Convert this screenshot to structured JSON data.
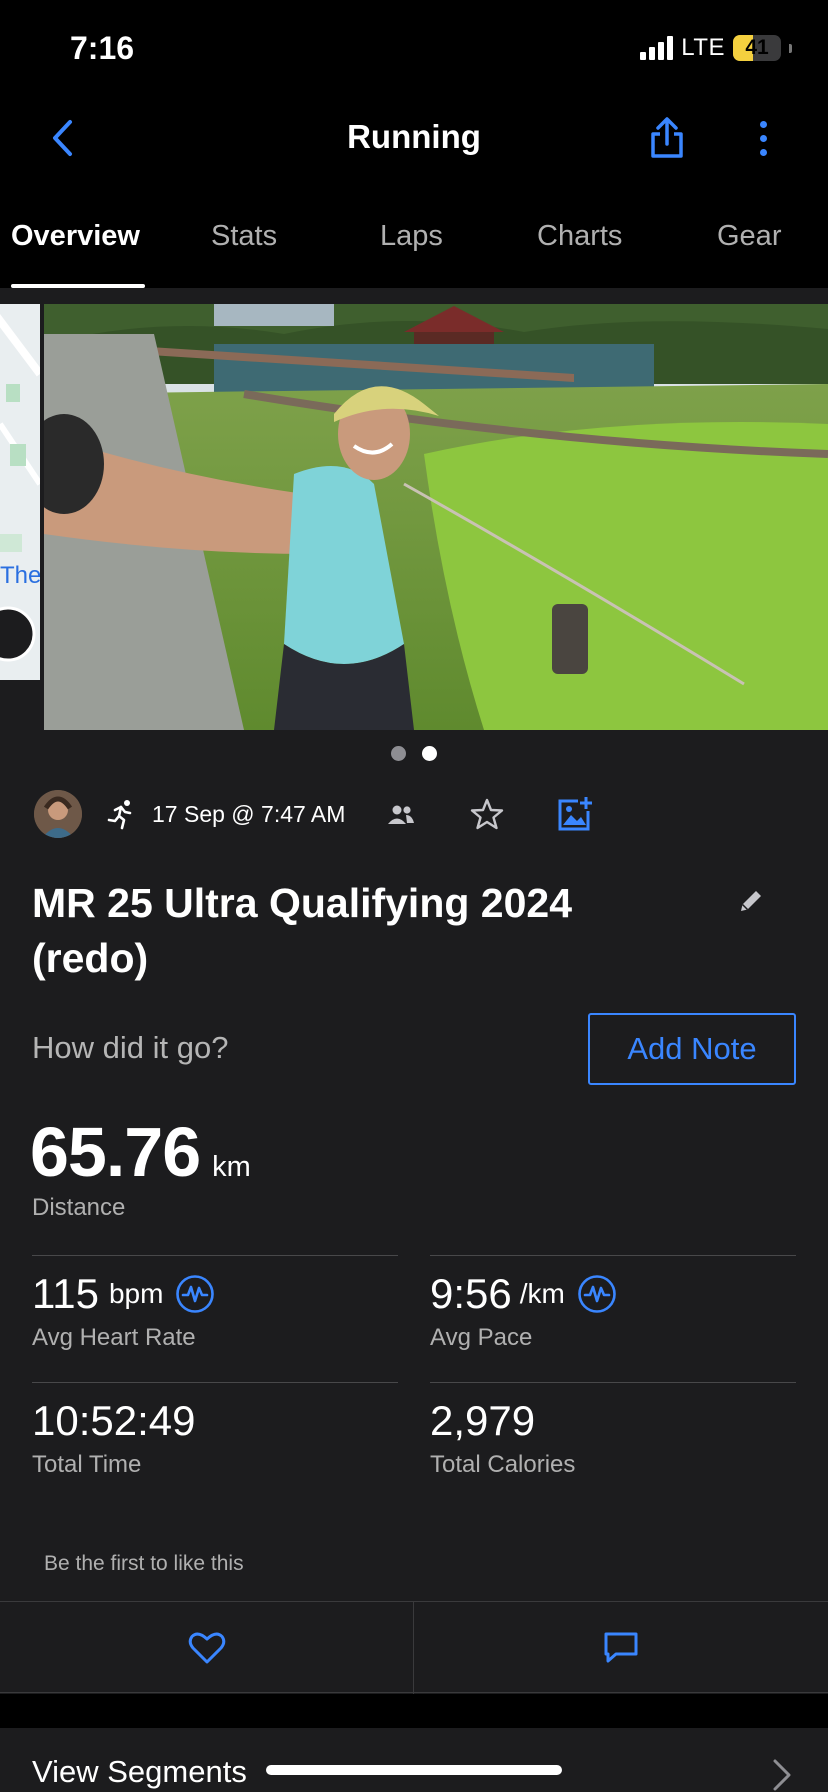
{
  "status_bar": {
    "time": "7:16",
    "network": "LTE",
    "battery_level": "41",
    "battery_fraction": 0.41,
    "battery_color": "#f4d03f"
  },
  "nav": {
    "title": "Running",
    "back_icon": "chevron-left-icon",
    "share_icon": "share-icon",
    "more_icon": "more-vertical-icon",
    "accent_color": "#3a86ff"
  },
  "tabs": [
    {
      "label": "Overview",
      "active": true
    },
    {
      "label": "Stats",
      "active": false
    },
    {
      "label": "Laps",
      "active": false
    },
    {
      "label": "Charts",
      "active": false
    },
    {
      "label": "Gear",
      "active": false
    }
  ],
  "media": {
    "map_label": "The",
    "page_count": 2,
    "current_page": 2
  },
  "activity": {
    "type_icon": "running-icon",
    "date": "17 Sep @ 7:47 AM",
    "title": "MR 25 Ultra Qualifying 2024 (redo)"
  },
  "note": {
    "prompt": "How did it go?",
    "button": "Add Note"
  },
  "distance": {
    "value": "65.76",
    "unit": "km",
    "label": "Distance"
  },
  "stats": {
    "heart_rate": {
      "value": "115",
      "unit": "bpm",
      "label": "Avg Heart Rate"
    },
    "pace": {
      "value": "9:56",
      "unit": "/km",
      "label": "Avg Pace"
    },
    "time": {
      "value": "10:52:49",
      "label": "Total Time"
    },
    "calories": {
      "value": "2,979",
      "label": "Total Calories"
    }
  },
  "social": {
    "like_text": "Be the first to like this",
    "like_icon": "heart-icon",
    "comment_icon": "comment-icon"
  },
  "segments": {
    "label": "View Segments"
  }
}
